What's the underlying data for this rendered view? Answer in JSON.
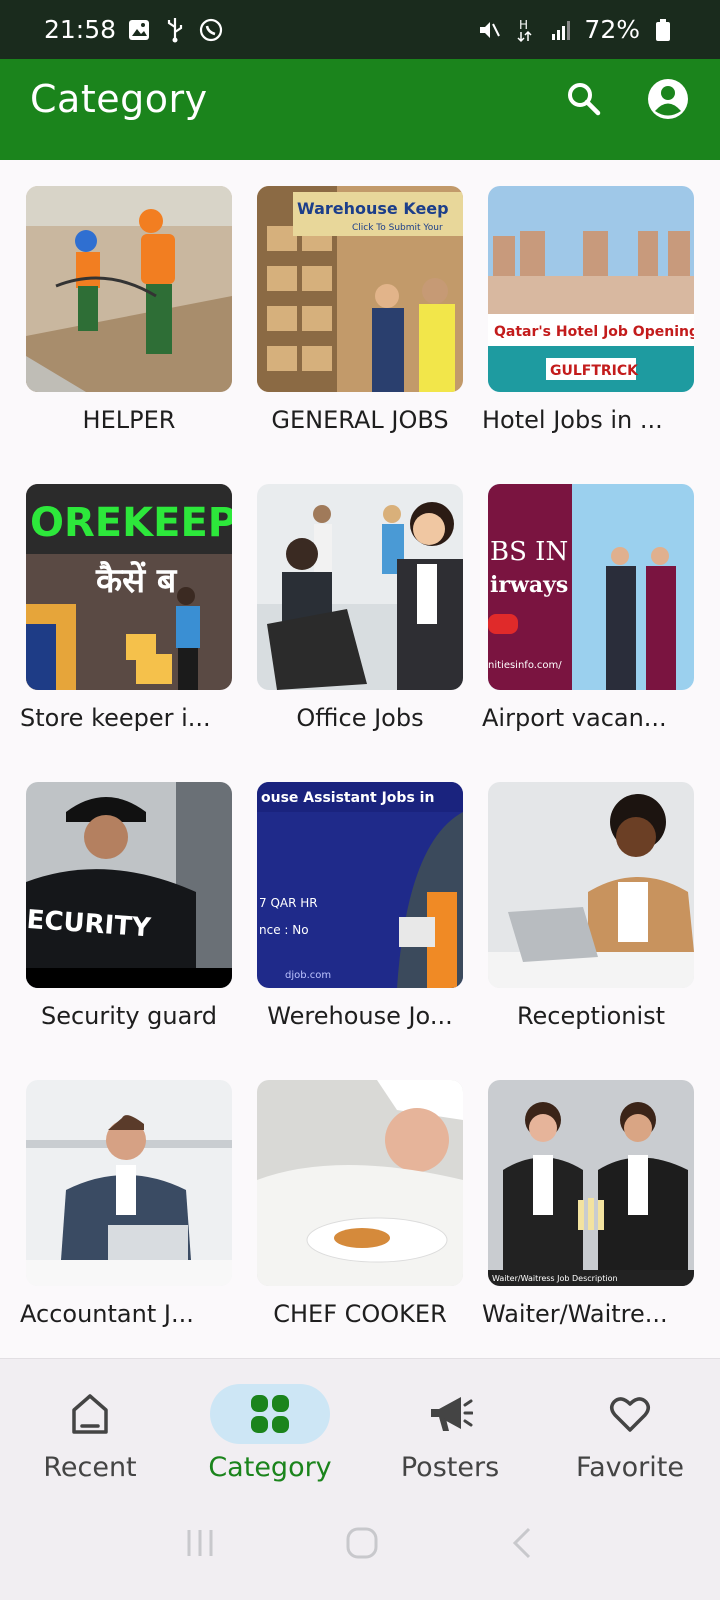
{
  "status": {
    "time": "21:58",
    "battery": "72%"
  },
  "app_bar": {
    "title": "Category"
  },
  "categories": [
    {
      "label": "HELPER"
    },
    {
      "label": "GENERAL JOBS",
      "overlay": "Warehouse Keep",
      "overlay_sub": "Click To Submit Your"
    },
    {
      "label": "Hotel Jobs in ...",
      "overlay": "Qatar's Hotel Job Openings",
      "overlay_sub": "GULFTRICK"
    },
    {
      "label": "Store keeper i...",
      "overlay": "OREKEEP",
      "overlay_sub": "कैसें ब"
    },
    {
      "label": "Office Jobs"
    },
    {
      "label": "Airport vacan...",
      "overlay": "BS IN",
      "overlay_sub": "irways",
      "overlay_foot": "nitiesinfo.com/"
    },
    {
      "label": "Security guard",
      "overlay": "ECURITY"
    },
    {
      "label": "Werehouse Jo...",
      "overlay": "ouse Assistant Jobs in",
      "overlay_sub": "7 QAR HR",
      "overlay_sub2": "nce : No",
      "overlay_foot": "djob.com"
    },
    {
      "label": "Receptionist"
    },
    {
      "label": "Accountant J..."
    },
    {
      "label": "CHEF COOKER"
    },
    {
      "label": "Waiter/Waitre...",
      "overlay_foot": "Waiter/Waitress Job Description"
    }
  ],
  "bottom_nav": [
    {
      "label": "Recent",
      "icon": "home-icon"
    },
    {
      "label": "Category",
      "icon": "grid-icon",
      "active": true
    },
    {
      "label": "Posters",
      "icon": "megaphone-icon"
    },
    {
      "label": "Favorite",
      "icon": "heart-icon"
    }
  ],
  "colors": {
    "primary": "#1b841c",
    "active_pill": "#cde6f5",
    "status_bar": "#1a2b1d"
  }
}
